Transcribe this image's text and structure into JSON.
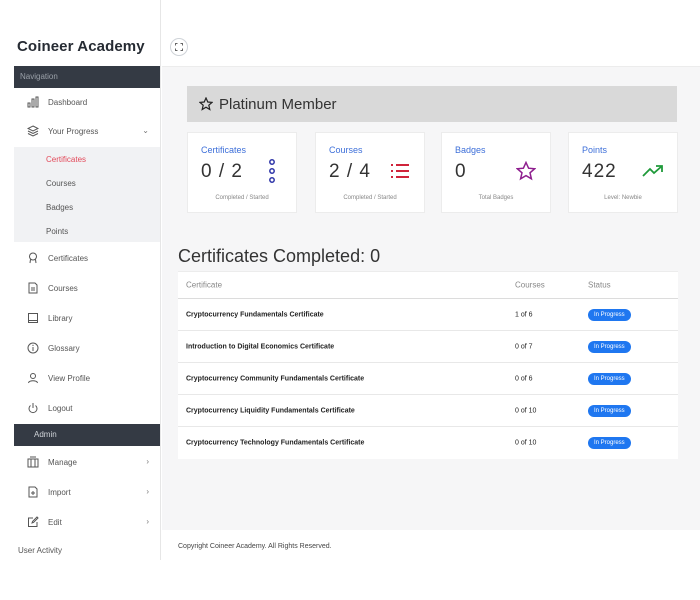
{
  "sidebar": {
    "brand": "Coineer Academy",
    "nav_header": "Navigation",
    "admin_header": "Admin",
    "items": {
      "dashboard": "Dashboard",
      "your_progress": "Your Progress",
      "certificates": "Certificates",
      "courses": "Courses",
      "library": "Library",
      "glossary": "Glossary",
      "view_profile": "View Profile",
      "logout": "Logout",
      "manage": "Manage",
      "import": "Import",
      "edit": "Edit",
      "user_activity": "User Activity"
    },
    "progress_submenu": {
      "certificates": "Certificates",
      "courses": "Courses",
      "badges": "Badges",
      "points": "Points"
    }
  },
  "main": {
    "membership": "Platinum Member",
    "cards": {
      "certificates": {
        "title": "Certificates",
        "value": "0 / 2",
        "sub": "Completed / Started"
      },
      "courses": {
        "title": "Courses",
        "value": "2 / 4",
        "sub": "Completed / Started"
      },
      "badges": {
        "title": "Badges",
        "value": "0",
        "sub": "Total Badges"
      },
      "points": {
        "title": "Points",
        "value": "422",
        "sub": "Level: Newbie"
      }
    },
    "table": {
      "title": "Certificates Completed: 0",
      "headers": {
        "certificate": "Certificate",
        "courses": "Courses",
        "status": "Status"
      },
      "rows": [
        {
          "certificate": "Cryptocurrency Fundamentals Certificate",
          "courses": "1 of 6",
          "status": "In Progress"
        },
        {
          "certificate": "Introduction to Digital Economics Certificate",
          "courses": "0 of 7",
          "status": "In Progress"
        },
        {
          "certificate": "Cryptocurrency Community Fundamentals Certificate",
          "courses": "0 of 6",
          "status": "In Progress"
        },
        {
          "certificate": "Cryptocurrency Liquidity Fundamentals Certificate",
          "courses": "0 of 10",
          "status": "In Progress"
        },
        {
          "certificate": "Cryptocurrency Technology Fundamentals Certificate",
          "courses": "0 of 10",
          "status": "In Progress"
        }
      ]
    },
    "footer": "Copyright Coineer Academy. All Rights Reserved."
  },
  "colors": {
    "accent_blue": "#3d6fd9",
    "active_red": "#e34a5a",
    "badge_blue": "#1f77f0",
    "sidebar_header": "#343a44"
  }
}
